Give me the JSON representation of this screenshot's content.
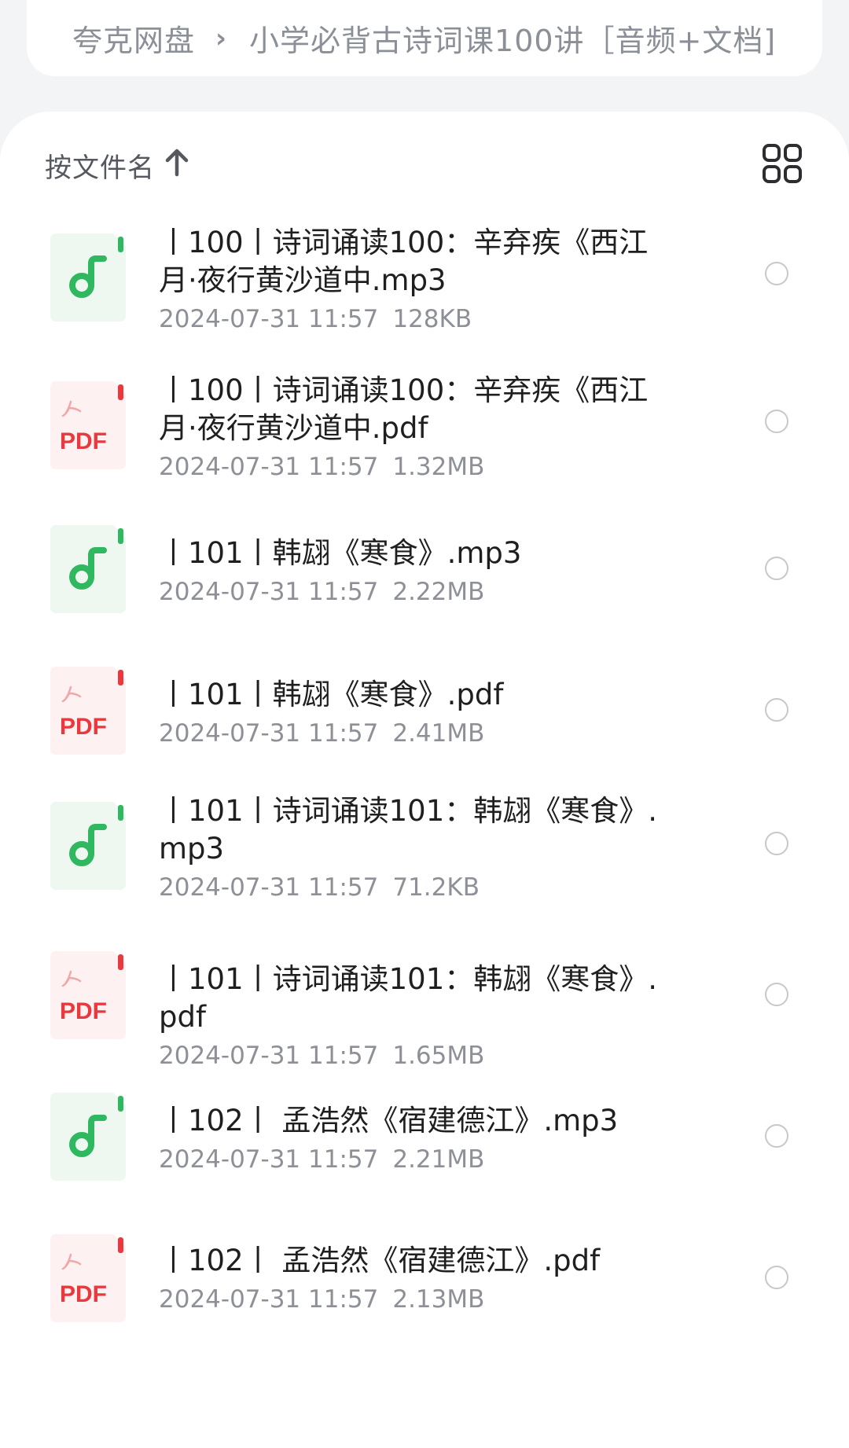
{
  "breadcrumb": {
    "root": "夸克网盘",
    "separator": "›",
    "current": "小学必背古诗词课100讲［音频+文档]"
  },
  "sort": {
    "label": "按文件名",
    "direction_icon": "arrow-up-icon"
  },
  "view_toggle_icon": "grid-view-icon",
  "colors": {
    "audio_icon_bg": "#eef8f1",
    "audio_accent": "#2fb85f",
    "pdf_icon_bg": "#fdf1f1",
    "pdf_accent": "#e8393e",
    "meta_text": "#8d9096"
  },
  "files": [
    {
      "type": "audio",
      "icon": "audio-file-icon",
      "name": "丨100丨诗词诵读100：辛弃疾《西江月·夜行黄沙道中.mp3",
      "date": "2024-07-31 11:57",
      "size": "128KB"
    },
    {
      "type": "pdf",
      "icon": "pdf-file-icon",
      "icon_label": "PDF",
      "name": "丨100丨诗词诵读100：辛弃疾《西江月·夜行黄沙道中.pdf",
      "date": "2024-07-31 11:57",
      "size": "1.32MB"
    },
    {
      "type": "audio",
      "icon": "audio-file-icon",
      "name": "丨101丨韩翃《寒食》.mp3",
      "date": "2024-07-31 11:57",
      "size": "2.22MB"
    },
    {
      "type": "pdf",
      "icon": "pdf-file-icon",
      "icon_label": "PDF",
      "name": "丨101丨韩翃《寒食》.pdf",
      "date": "2024-07-31 11:57",
      "size": "2.41MB"
    },
    {
      "type": "audio",
      "icon": "audio-file-icon",
      "name": "丨101丨诗词诵读101：韩翃《寒食》.mp3",
      "date": "2024-07-31 11:57",
      "size": "71.2KB"
    },
    {
      "type": "pdf",
      "icon": "pdf-file-icon",
      "icon_label": "PDF",
      "name": "丨101丨诗词诵读101：韩翃《寒食》.pdf",
      "date": "2024-07-31 11:57",
      "size": "1.65MB"
    },
    {
      "type": "audio",
      "icon": "audio-file-icon",
      "name": "丨102丨 孟浩然《宿建德江》.mp3",
      "date": "2024-07-31 11:57",
      "size": "2.21MB"
    },
    {
      "type": "pdf",
      "icon": "pdf-file-icon",
      "icon_label": "PDF",
      "name": "丨102丨 孟浩然《宿建德江》.pdf",
      "date": "2024-07-31 11:57",
      "size": "2.13MB"
    }
  ]
}
